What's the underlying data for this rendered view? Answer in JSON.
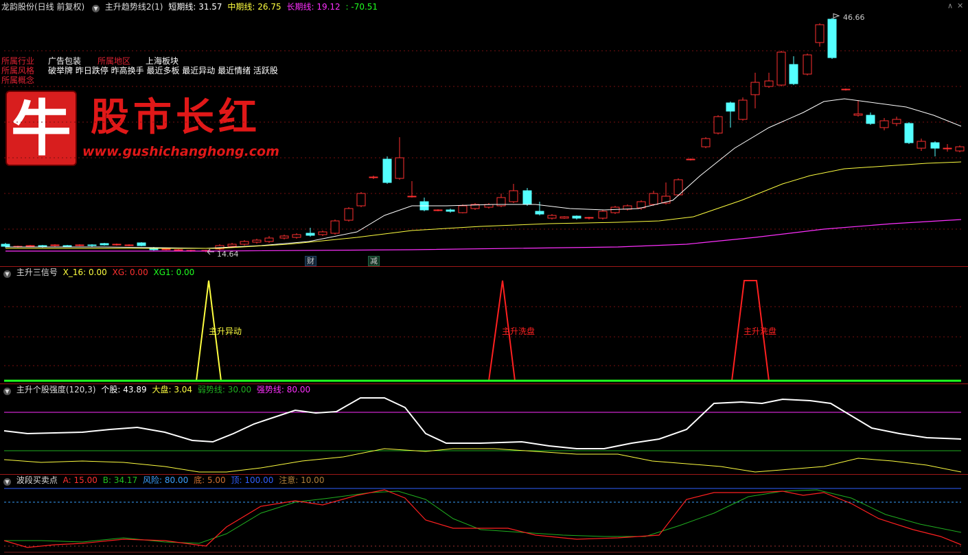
{
  "main": {
    "stock_label": "龙韵股份(日线 前复权)",
    "indicator_name": "主升趋势线2(1)",
    "short_label": "短期线:",
    "short_value": "31.57",
    "mid_label": "中期线:",
    "mid_value": "26.75",
    "long_label": "长期线:",
    "long_value": "19.12",
    "extra_value": ": -70.51",
    "high_label": "46.66",
    "low_label": "14.64",
    "tag_cai": "财",
    "tag_jian": "减"
  },
  "info": {
    "industry_label": "所属行业",
    "industry_value": "广告包装",
    "region_label": "所属地区",
    "region_value": "上海板块",
    "style_label": "所属风格",
    "style_value": "破举牌 昨日跌停 昨高换手 最近多板 最近异动 最近情绪 活跃股",
    "concept_label": "所属概念"
  },
  "brand": {
    "logo_char": "牛",
    "title": "股市长红",
    "url": "www.gushichanghong.com"
  },
  "pane2": {
    "name": "主升三信号",
    "x16_label": "X_16:",
    "x16_value": "0.00",
    "xg_label": "XG:",
    "xg_value": "0.00",
    "xg1_label": "XG1:",
    "xg1_value": "0.00",
    "sig1": "主升异动",
    "sig2": "主升洗盘",
    "sig3": "主升洗盘"
  },
  "pane3": {
    "name": "主升个股强度(120,3)",
    "stock_label": "个股:",
    "stock_value": "43.89",
    "market_label": "大盘:",
    "market_value": "3.04",
    "weak_label": "弱势线:",
    "weak_value": "30.00",
    "strong_label": "强势线:",
    "strong_value": "80.00"
  },
  "pane4": {
    "name": "波段买卖点",
    "a_label": "A:",
    "a_value": "15.00",
    "b_label": "B:",
    "b_value": "34.17",
    "risk_label": "风险:",
    "risk_value": "80.00",
    "bottom_label": "底:",
    "bottom_value": "5.00",
    "top_label": "顶:",
    "top_value": "100.00",
    "attn_label": "注意:",
    "attn_value": "10.00"
  },
  "colors": {
    "up": "#ff3030",
    "down": "#54ffff",
    "short_line": "#ffffff",
    "mid_line": "#ffff40",
    "long_line": "#ff30ff",
    "signal_green": "#20ff20"
  }
}
